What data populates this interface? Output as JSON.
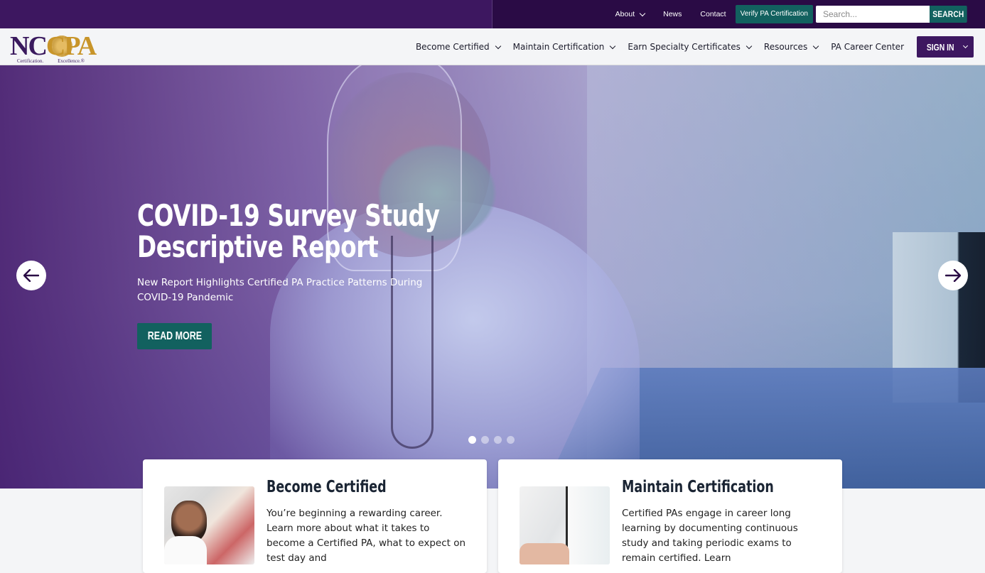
{
  "utility_bar": {
    "links": [
      {
        "label": "About",
        "has_dropdown": true
      },
      {
        "label": "News",
        "has_dropdown": false
      },
      {
        "label": "Contact",
        "has_dropdown": false
      }
    ],
    "verify_label": "Verify PA Certification",
    "search": {
      "placeholder": "Search...",
      "value": "",
      "button_label": "SEARCH"
    }
  },
  "header": {
    "logo": {
      "name": "NCCPA",
      "nc": "NC",
      "c": "C",
      "pa": "PA",
      "tagline_left": "Certification.",
      "tagline_right": "Excellence.®"
    },
    "nav": [
      {
        "label": "Become Certified",
        "has_dropdown": true
      },
      {
        "label": "Maintain Certification",
        "has_dropdown": true
      },
      {
        "label": "Earn Specialty Certificates",
        "has_dropdown": true
      },
      {
        "label": "Resources",
        "has_dropdown": true
      },
      {
        "label": "PA Career Center",
        "has_dropdown": false
      }
    ],
    "sign_in_label": "SIGN IN"
  },
  "hero": {
    "title_line1": "COVID-19 Survey Study",
    "title_line2": "Descriptive Report",
    "subtitle": "New Report Highlights Certified PA Practice Patterns During COVID-19 Pandemic",
    "cta_label": "READ MORE",
    "slide_count": 4,
    "active_slide": 1,
    "prev_icon": "arrow-left-icon",
    "next_icon": "arrow-right-icon"
  },
  "cards": [
    {
      "title": "Become Certified",
      "body": "You’re beginning a rewarding career. Learn more about what it takes to become a Certified PA, what to expect on test day and"
    },
    {
      "title": "Maintain Certification",
      "body": "Certified PAs engage in career long learning by documenting continuous study and taking periodic exams to remain certified. Learn"
    }
  ],
  "colors": {
    "brand_purple": "#3d1760",
    "utility_dark": "#2a0b45",
    "teal_accent": "#12615f",
    "gold": "#c8952a"
  }
}
